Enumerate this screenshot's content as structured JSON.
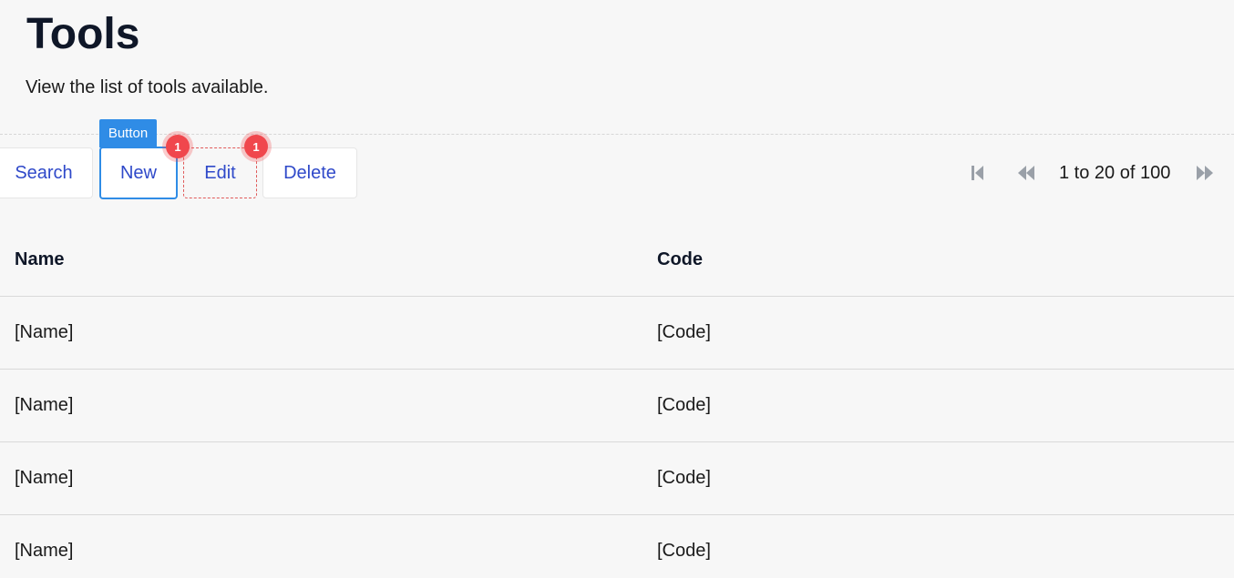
{
  "header": {
    "title": "Tools",
    "subtitle": "View the list of tools available."
  },
  "toolbar": {
    "search_label": "Search",
    "new_label": "New",
    "edit_label": "Edit",
    "delete_label": "Delete",
    "selection_tag": "Button",
    "badge_new": "1",
    "badge_edit": "1"
  },
  "pager": {
    "text": "1 to 20 of 100",
    "icons": [
      "first-page-icon",
      "previous-page-icon",
      "next-page-icon"
    ]
  },
  "table": {
    "headers": [
      "Name",
      "Code"
    ],
    "rows": [
      [
        "[Name]",
        "[Code]"
      ],
      [
        "[Name]",
        "[Code]"
      ],
      [
        "[Name]",
        "[Code]"
      ],
      [
        "[Name]",
        "[Code]"
      ]
    ]
  },
  "colors": {
    "accent": "#2f8ce6",
    "link": "#2f49c9",
    "badge": "#f0474d",
    "background": "#f7f7f7"
  }
}
